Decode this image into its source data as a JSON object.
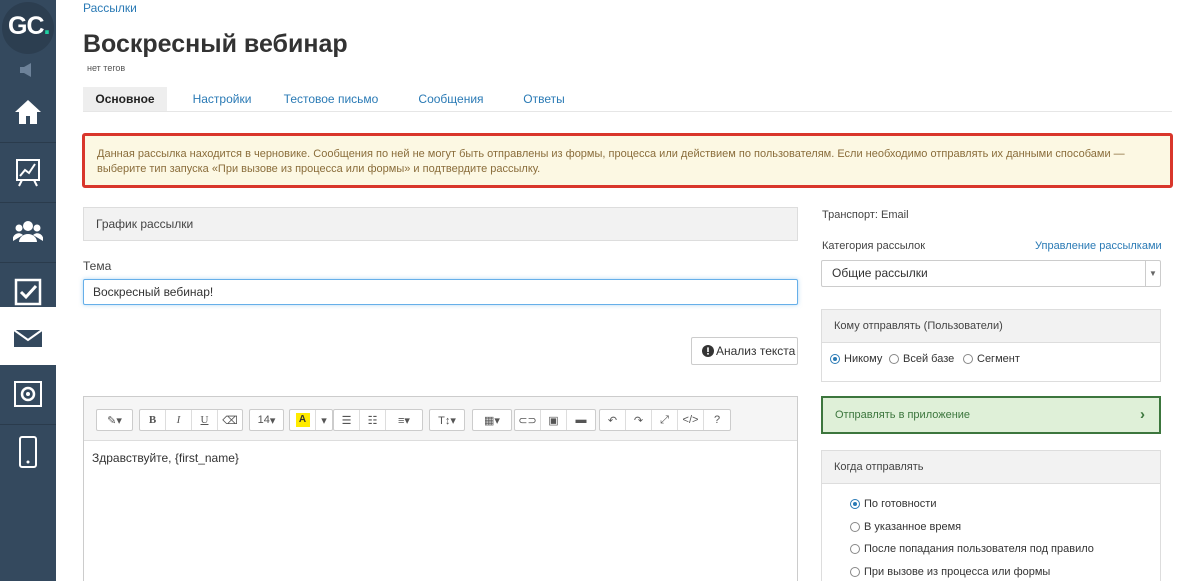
{
  "sidebar": {
    "logo_main": "GC",
    "logo_dot": ".",
    "items": [
      {
        "name": "home"
      },
      {
        "name": "analytics"
      },
      {
        "name": "users"
      },
      {
        "name": "tasks"
      },
      {
        "name": "mail"
      },
      {
        "name": "settings"
      },
      {
        "name": "mobile"
      }
    ]
  },
  "breadcrumb": "Рассылки",
  "page_title": "Воскресный вебинар",
  "tags": "нет тегов",
  "tabs": [
    "Основное",
    "Настройки",
    "Тестовое письмо",
    "Сообщения",
    "Ответы"
  ],
  "alert_text": "Данная рассылка находится в черновике. Сообщения по ней не могут быть отправлены из формы, процесса или действием по пользователям. Если необходимо отправлять их данными способами — выберите тип запуска «При вызове из процесса или формы» и подтвердите рассылку.",
  "schedule_label": "График рассылки",
  "subject": {
    "label": "Тема",
    "value": "Воскресный вебинар!"
  },
  "analyze_button": "Анализ текста",
  "editor": {
    "font_size": "14",
    "body": "Здравствуйте, {first_name}"
  },
  "transport": "Транспорт: Email",
  "category": {
    "label": "Категория рассылок",
    "manage_link": "Управление рассылками",
    "selected": "Общие рассылки"
  },
  "recipients": {
    "title": "Кому отправлять (Пользователи)",
    "options": [
      "Никому",
      "Всей базе",
      "Сегмент"
    ],
    "selected_index": 0
  },
  "app_send": "Отправлять в приложение",
  "when": {
    "title": "Когда отправлять",
    "options": [
      "По готовности",
      "В указанное время",
      "После попадания пользователя под правило",
      "При вызове из процесса или формы"
    ],
    "selected_index": 0
  },
  "colors": {
    "sidebar": "#34495e",
    "link": "#2a7ab5",
    "alert_border": "#d9362b",
    "alert_bg": "#fcf8e3",
    "success_bg": "#dff0d8",
    "success_border": "#3c763d"
  }
}
